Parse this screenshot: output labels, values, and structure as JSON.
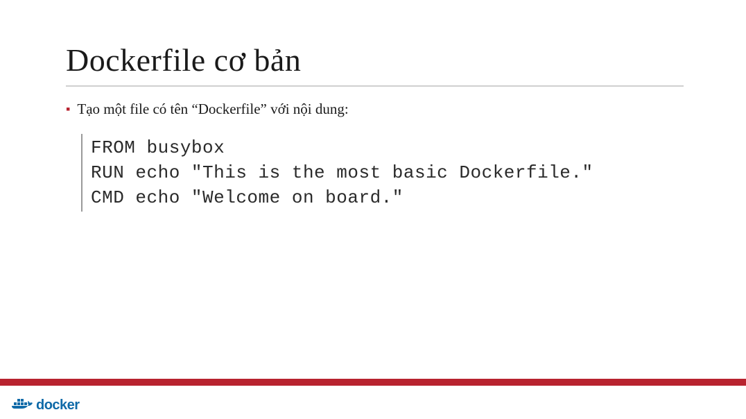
{
  "title": "Dockerfile cơ bản",
  "bullet": "Tạo một file có tên “Dockerfile” với nội dung:",
  "code": "FROM busybox\nRUN echo \"This is the most basic Dockerfile.\"\nCMD echo \"Welcome on board.\"",
  "logo_text": "docker"
}
